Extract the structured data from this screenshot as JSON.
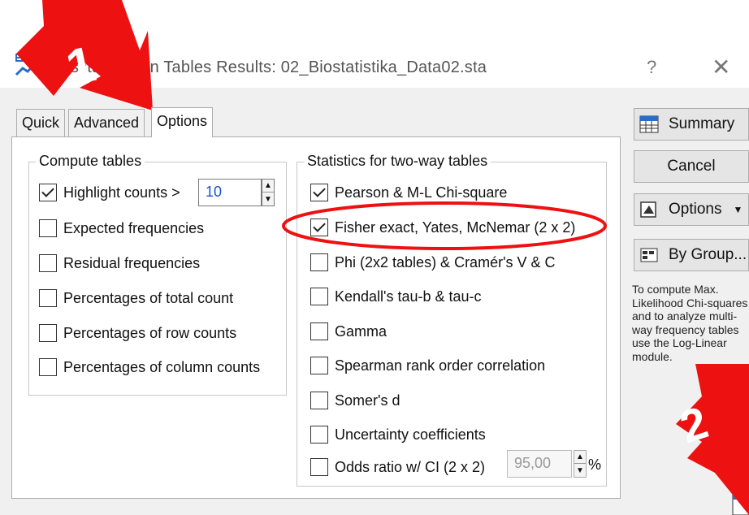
{
  "window": {
    "title": "Crosstabulation Tables Results: 02_Biostatistika_Data02.sta",
    "help_label": "?",
    "close_label": "✕"
  },
  "tabs": [
    {
      "label": "Quick",
      "active": false
    },
    {
      "label": "Advanced",
      "active": false
    },
    {
      "label": "Options",
      "active": true
    }
  ],
  "compute_tables": {
    "title": "Compute tables",
    "highlight": {
      "label": "Highlight counts >",
      "checked": true,
      "value": "10"
    },
    "items": [
      {
        "label": "Expected frequencies",
        "checked": false
      },
      {
        "label": "Residual frequencies",
        "checked": false
      },
      {
        "label": "Percentages of total count",
        "checked": false
      },
      {
        "label": "Percentages of row counts",
        "checked": false
      },
      {
        "label": "Percentages of column counts",
        "checked": false
      }
    ]
  },
  "two_way_stats": {
    "title": "Statistics for two-way tables",
    "items": [
      {
        "label": "Pearson & M-L Chi-square",
        "checked": true
      },
      {
        "label": "Fisher exact, Yates, McNemar (2 x 2)",
        "checked": true
      },
      {
        "label": "Phi (2x2 tables) & Cramér's V & C",
        "checked": false
      },
      {
        "label": "Kendall's tau-b & tau-c",
        "checked": false
      },
      {
        "label": "Gamma",
        "checked": false
      },
      {
        "label": "Spearman rank order correlation",
        "checked": false
      },
      {
        "label": "Somer's d",
        "checked": false
      },
      {
        "label": "Uncertainty coefficients",
        "checked": false
      }
    ],
    "odds_ratio": {
      "label": "Odds ratio w/ CI (2 x 2)",
      "checked": false,
      "value": "95,00",
      "unit": "%"
    }
  },
  "side_buttons": {
    "summary": "Summary",
    "cancel": "Cancel",
    "options": "Options",
    "options_arrow": "▼",
    "by_group": "By Group..."
  },
  "hint_text": "To compute Max. Likelihood Chi-squares and to analyze multi-way frequency tables use the Log-Linear module.",
  "annotations": {
    "arrow1_label": "1",
    "arrow2_label": "2",
    "color": "#ee1111"
  },
  "colors": {
    "spin_value": "#1a4fd6",
    "annotation_red": "#ee1111"
  }
}
